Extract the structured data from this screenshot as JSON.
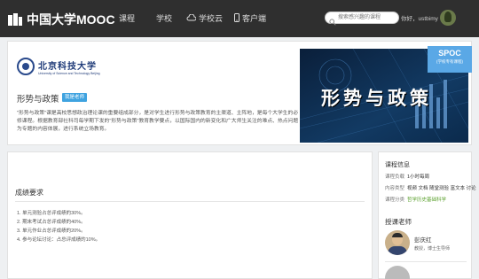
{
  "topbar": {
    "logo_text": "中国大学MOOC",
    "nav": [
      {
        "label": "课程",
        "icon": ""
      },
      {
        "label": "学校",
        "icon": ""
      },
      {
        "label": "学校云",
        "icon": "cloud-icon"
      },
      {
        "label": "客户端",
        "icon": "phone-icon"
      }
    ],
    "search_placeholder": "搜索感兴趣的课程",
    "greeting": "你好，ustbimy"
  },
  "course": {
    "school_name_cn": "北京科技大学",
    "school_name_en": "University of Science and Technology Beijing",
    "title": "形势与政策",
    "badge": "我是老师",
    "description": "\"形势与政策\"课是高校思想政治理论课的重要组成部分，是对学生进行形势与政策教育的主渠道、主阵地，是每个大学生的必修课程。根据教育部社科司每学期下发的\"形势与政策\"教育教学要点，以国际国内的新变化和广大师生关注的难点、热点问题为专题的内容体展，进行系统立场教育。",
    "banner_title": "形势与政策",
    "spoc_title": "SPOC",
    "spoc_subtitle": "(学校专有课程)"
  },
  "requirements": {
    "title": "成绩要求",
    "items": [
      "1. 单元测验占总评成绩的30%。",
      "2. 期末考试占总评成绩的40%。",
      "3. 单元作业占总评成绩的20%。",
      "4. 参与论坛讨论：占总评成绩的10%。"
    ]
  },
  "course_info": {
    "title": "课程信息",
    "rows": [
      {
        "key": "课程负载",
        "value": "1小时每周"
      },
      {
        "key": "内容类型",
        "value": "视频 文档 随堂测验 富文本 讨论"
      },
      {
        "key": "课程分类",
        "value": "哲学历史基础科学"
      }
    ]
  },
  "teachers": {
    "title": "授课老师",
    "list": [
      {
        "name": "彭庆红",
        "role": "教授，博士生导师"
      }
    ]
  },
  "colors": {
    "topbar": "#2f2f2f",
    "accent_blue": "#3fa3e0",
    "spoc": "#5aa8e6",
    "category_green": "#5aa02c"
  }
}
